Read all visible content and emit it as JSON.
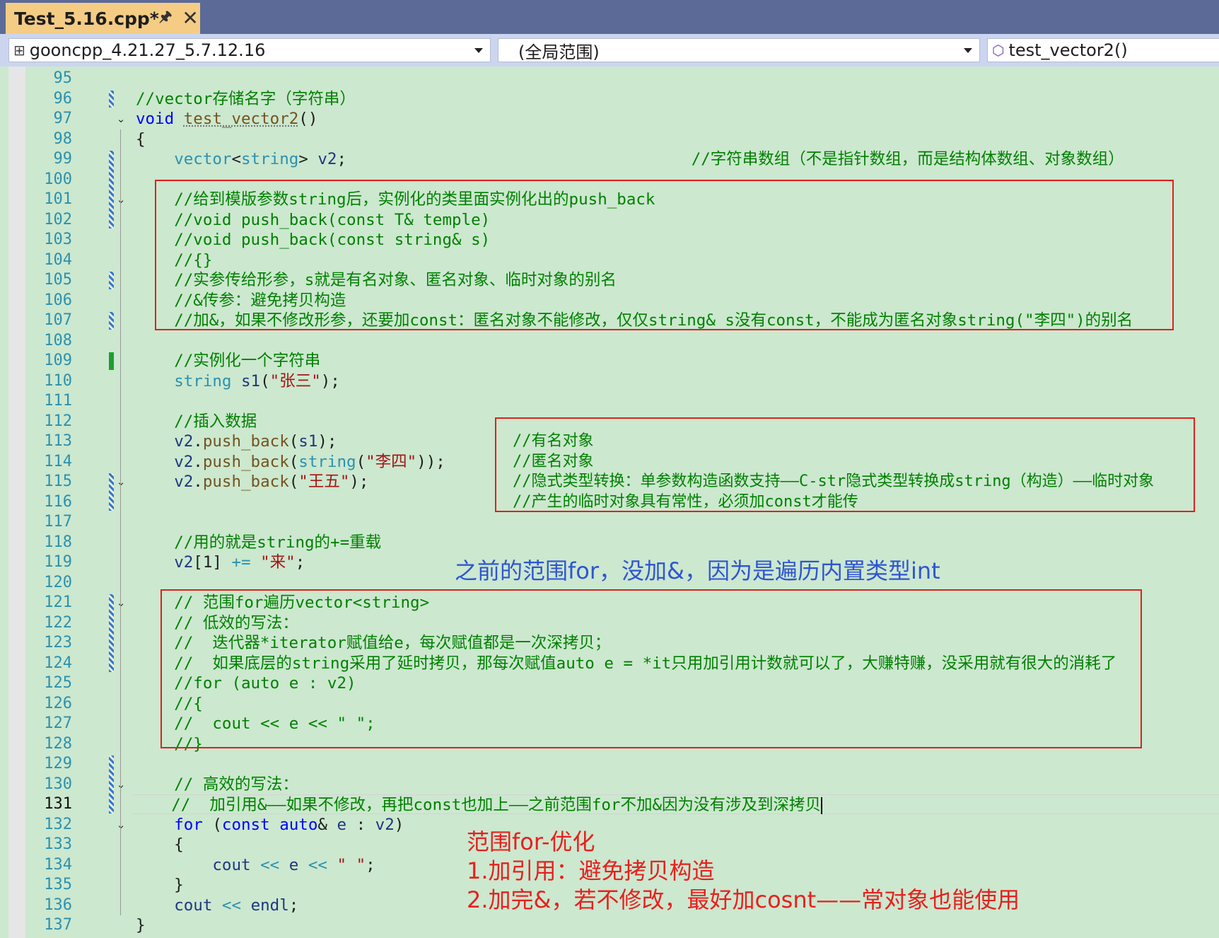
{
  "tab": {
    "title": "Test_5.16.cpp*",
    "pin_icon": "pin-icon",
    "close_glyph": "✕"
  },
  "nav": {
    "project": "gooncpp_4.21.27_5.7.12.16",
    "scope": "(全局范围)",
    "member": "test_vector2()"
  },
  "editor": {
    "current_line": 131,
    "lines": [
      {
        "n": "95",
        "segs": []
      },
      {
        "n": "96",
        "segs": [
          {
            "t": "//vector存储名字（字符串）",
            "c": "c"
          }
        ]
      },
      {
        "n": "97",
        "segs": [
          {
            "t": "void",
            "c": "k"
          },
          {
            "t": " "
          },
          {
            "t": "test_vector2",
            "c": "f squiggle"
          },
          {
            "t": "()"
          }
        ]
      },
      {
        "n": "98",
        "segs": [
          {
            "t": "{"
          }
        ]
      },
      {
        "n": "99",
        "segs": [
          {
            "t": "    "
          },
          {
            "t": "vector",
            "c": "t"
          },
          {
            "t": "<"
          },
          {
            "t": "string",
            "c": "t"
          },
          {
            "t": "> "
          },
          {
            "t": "v2",
            "c": "v"
          },
          {
            "t": ";                                    "
          },
          {
            "t": "//字符串数组（不是指针数组，而是结构体数组、对象数组）",
            "c": "c"
          }
        ]
      },
      {
        "n": "100",
        "segs": []
      },
      {
        "n": "101",
        "segs": [
          {
            "t": "    "
          },
          {
            "t": "//给到模版参数string后，实例化的类里面实例化出的push_back",
            "c": "c"
          }
        ]
      },
      {
        "n": "102",
        "segs": [
          {
            "t": "    "
          },
          {
            "t": "//void push_back(const T& temple)",
            "c": "c"
          }
        ]
      },
      {
        "n": "103",
        "segs": [
          {
            "t": "    "
          },
          {
            "t": "//void push_back(const string& s)",
            "c": "c"
          }
        ]
      },
      {
        "n": "104",
        "segs": [
          {
            "t": "    "
          },
          {
            "t": "//{}",
            "c": "c"
          }
        ]
      },
      {
        "n": "105",
        "segs": [
          {
            "t": "    "
          },
          {
            "t": "//实参传给形参，s就是有名对象、匿名对象、临时对象的别名",
            "c": "c"
          }
        ]
      },
      {
        "n": "106",
        "segs": [
          {
            "t": "    "
          },
          {
            "t": "//&传参：避免拷贝构造",
            "c": "c"
          }
        ]
      },
      {
        "n": "107",
        "segs": [
          {
            "t": "    "
          },
          {
            "t": "//加&，如果不修改形参，还要加const：匿名对象不能修改，仅仅string& s没有const，不能成为匿名对象string(\"李四\")的别名",
            "c": "c"
          }
        ]
      },
      {
        "n": "108",
        "segs": []
      },
      {
        "n": "109",
        "segs": [
          {
            "t": "    "
          },
          {
            "t": "//实例化一个字符串",
            "c": "c"
          }
        ]
      },
      {
        "n": "110",
        "segs": [
          {
            "t": "    "
          },
          {
            "t": "string",
            "c": "t"
          },
          {
            "t": " "
          },
          {
            "t": "s1",
            "c": "v"
          },
          {
            "t": "("
          },
          {
            "t": "\"张三\"",
            "c": "s"
          },
          {
            "t": ");"
          }
        ]
      },
      {
        "n": "111",
        "segs": []
      },
      {
        "n": "112",
        "segs": [
          {
            "t": "    "
          },
          {
            "t": "//插入数据",
            "c": "c"
          }
        ]
      },
      {
        "n": "113",
        "segs": [
          {
            "t": "    "
          },
          {
            "t": "v2",
            "c": "v"
          },
          {
            "t": "."
          },
          {
            "t": "push_back",
            "c": "f"
          },
          {
            "t": "("
          },
          {
            "t": "s1",
            "c": "v"
          },
          {
            "t": ");"
          }
        ]
      },
      {
        "n": "114",
        "segs": [
          {
            "t": "    "
          },
          {
            "t": "v2",
            "c": "v"
          },
          {
            "t": "."
          },
          {
            "t": "push_back",
            "c": "f"
          },
          {
            "t": "("
          },
          {
            "t": "string",
            "c": "t"
          },
          {
            "t": "("
          },
          {
            "t": "\"李四\"",
            "c": "s"
          },
          {
            "t": "));"
          }
        ]
      },
      {
        "n": "115",
        "segs": [
          {
            "t": "    "
          },
          {
            "t": "v2",
            "c": "v"
          },
          {
            "t": "."
          },
          {
            "t": "push_back",
            "c": "f"
          },
          {
            "t": "("
          },
          {
            "t": "\"王五\"",
            "c": "s"
          },
          {
            "t": ");"
          }
        ]
      },
      {
        "n": "116",
        "segs": []
      },
      {
        "n": "117",
        "segs": []
      },
      {
        "n": "118",
        "segs": [
          {
            "t": "    "
          },
          {
            "t": "//用的就是string的+=重载",
            "c": "c"
          }
        ]
      },
      {
        "n": "119",
        "segs": [
          {
            "t": "    "
          },
          {
            "t": "v2",
            "c": "v"
          },
          {
            "t": "[1] "
          },
          {
            "t": "+=",
            "c": "t"
          },
          {
            "t": " "
          },
          {
            "t": "\"来\"",
            "c": "s"
          },
          {
            "t": ";"
          }
        ]
      },
      {
        "n": "120",
        "segs": []
      },
      {
        "n": "121",
        "segs": [
          {
            "t": "    "
          },
          {
            "t": "// 范围for遍历vector<string>",
            "c": "c"
          }
        ]
      },
      {
        "n": "122",
        "segs": [
          {
            "t": "    "
          },
          {
            "t": "// 低效的写法：",
            "c": "c"
          }
        ]
      },
      {
        "n": "123",
        "segs": [
          {
            "t": "    "
          },
          {
            "t": "//  迭代器*iterator赋值给e，每次赋值都是一次深拷贝；",
            "c": "c"
          }
        ]
      },
      {
        "n": "124",
        "segs": [
          {
            "t": "    "
          },
          {
            "t": "//  如果底层的string采用了延时拷贝，那每次赋值auto e = *it只用加引用计数就可以了，大赚特赚，没采用就有很大的消耗了",
            "c": "c"
          }
        ]
      },
      {
        "n": "125",
        "segs": [
          {
            "t": "    "
          },
          {
            "t": "//for (auto e : v2)",
            "c": "c"
          }
        ]
      },
      {
        "n": "126",
        "segs": [
          {
            "t": "    "
          },
          {
            "t": "//{",
            "c": "c"
          }
        ]
      },
      {
        "n": "127",
        "segs": [
          {
            "t": "    "
          },
          {
            "t": "//  cout << e << \" \";",
            "c": "c"
          }
        ]
      },
      {
        "n": "128",
        "segs": [
          {
            "t": "    "
          },
          {
            "t": "//}",
            "c": "c"
          }
        ]
      },
      {
        "n": "129",
        "segs": []
      },
      {
        "n": "130",
        "segs": [
          {
            "t": "    "
          },
          {
            "t": "// 高效的写法：",
            "c": "c"
          }
        ]
      },
      {
        "n": "131",
        "segs": [
          {
            "t": "    "
          },
          {
            "t": "//  加引用&——如果不修改，再把const也加上——之前范围for不加&因为没有涉及到深拷贝",
            "c": "c"
          }
        ]
      },
      {
        "n": "132",
        "segs": [
          {
            "t": "    "
          },
          {
            "t": "for",
            "c": "k"
          },
          {
            "t": " ("
          },
          {
            "t": "const",
            "c": "k"
          },
          {
            "t": " "
          },
          {
            "t": "auto",
            "c": "k"
          },
          {
            "t": "& "
          },
          {
            "t": "e",
            "c": "v"
          },
          {
            "t": " : "
          },
          {
            "t": "v2",
            "c": "v"
          },
          {
            "t": ")"
          }
        ]
      },
      {
        "n": "133",
        "segs": [
          {
            "t": "    {"
          }
        ]
      },
      {
        "n": "134",
        "segs": [
          {
            "t": "        "
          },
          {
            "t": "cout",
            "c": "v"
          },
          {
            "t": " "
          },
          {
            "t": "<<",
            "c": "t"
          },
          {
            "t": " "
          },
          {
            "t": "e",
            "c": "v"
          },
          {
            "t": " "
          },
          {
            "t": "<<",
            "c": "t"
          },
          {
            "t": " "
          },
          {
            "t": "\" \"",
            "c": "s"
          },
          {
            "t": ";"
          }
        ]
      },
      {
        "n": "135",
        "segs": [
          {
            "t": "    }"
          }
        ]
      },
      {
        "n": "136",
        "segs": [
          {
            "t": "    "
          },
          {
            "t": "cout",
            "c": "v"
          },
          {
            "t": " "
          },
          {
            "t": "<<",
            "c": "t"
          },
          {
            "t": " "
          },
          {
            "t": "endl",
            "c": "v"
          },
          {
            "t": ";"
          }
        ]
      },
      {
        "n": "137",
        "segs": [
          {
            "t": "}"
          }
        ]
      }
    ]
  },
  "annotation_box_lines": [
    "//有名对象",
    "//匿名对象",
    "//隐式类型转换：单参数构造函数支持——C-str隐式类型转换成string（构造）——临时对象",
    "//产生的临时对象具有常性，必须加const才能传"
  ],
  "annotations": {
    "blue_note": "之前的范围for，没加&，因为是遍历内置类型int",
    "red_title": "范围for-优化",
    "red_point1": "1.加引用：避免拷贝构造",
    "red_point2": "2.加完&，若不修改，最好加cosnt——常对象也能使用"
  },
  "colors": {
    "editor_bg": "#cce8cf",
    "tab_active": "#f5cc84",
    "comment": "#008000",
    "keyword": "#0000ff",
    "type": "#2b91af",
    "string": "#a31515",
    "highlight_box": "#e0201e"
  }
}
